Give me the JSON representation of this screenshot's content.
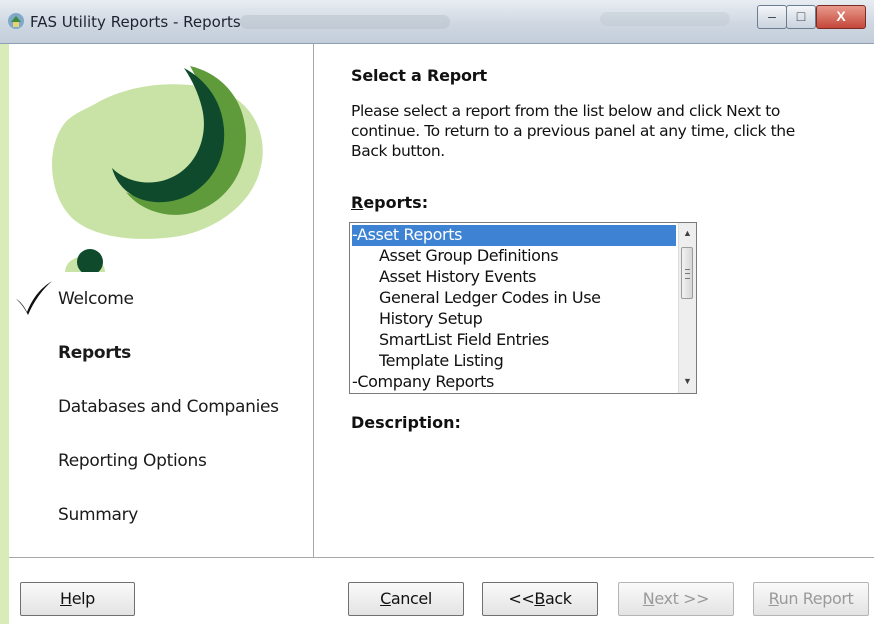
{
  "window": {
    "title": "FAS Utility Reports - Reports",
    "controls": {
      "minimize": "–",
      "maximize": "□",
      "close": "X"
    }
  },
  "nav": {
    "items": [
      {
        "label": "Welcome",
        "completed": true
      },
      {
        "label": "Reports",
        "active": true
      },
      {
        "label": "Databases and Companies"
      },
      {
        "label": "Reporting Options"
      },
      {
        "label": "Summary"
      }
    ]
  },
  "main": {
    "heading": "Select a Report",
    "instructions": "Please select a report from the list below and click Next to continue. To return to a previous panel at any time, click the Back button.",
    "reports_label": {
      "mnemonic": "R",
      "rest": "eports:"
    },
    "description_label": "Description:",
    "reports": [
      {
        "label": "-Asset Reports",
        "selected": true
      },
      {
        "label": "Asset Group Definitions"
      },
      {
        "label": "Asset History Events"
      },
      {
        "label": "General Ledger Codes in Use"
      },
      {
        "label": "History Setup"
      },
      {
        "label": "SmartList Field Entries"
      },
      {
        "label": "Template Listing"
      },
      {
        "label": "-Company Reports"
      }
    ]
  },
  "buttons": {
    "help": {
      "mnemonic": "H",
      "rest": "elp"
    },
    "cancel": {
      "mnemonic": "C",
      "rest": "ancel"
    },
    "back": {
      "pre": "<<",
      "mnemonic": "B",
      "rest": "ack"
    },
    "next": {
      "mnemonic": "N",
      "rest": "ext >>"
    },
    "run": {
      "mnemonic": "R",
      "rest": "un Report"
    }
  },
  "colors": {
    "selection": "#3e83d3",
    "logo_dark": "#0e4a2b",
    "logo_mid": "#5f9a3b",
    "logo_light": "#c8e3a5"
  }
}
